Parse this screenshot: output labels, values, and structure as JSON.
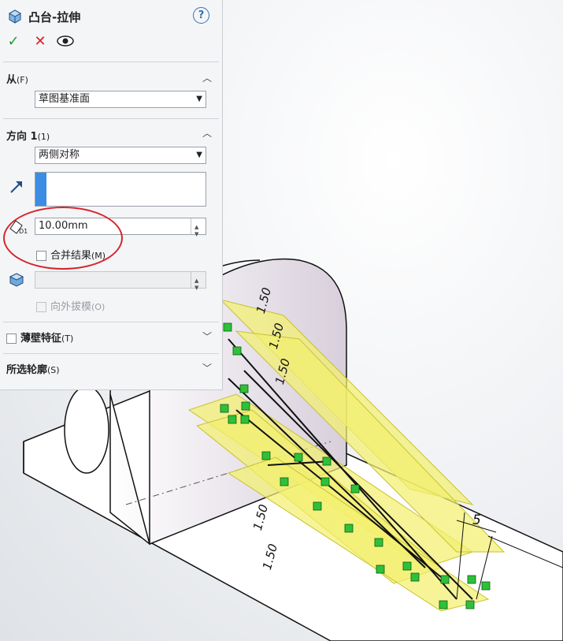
{
  "feature": {
    "title": "凸台-拉伸",
    "help": "?"
  },
  "actions": {
    "ok": "✓",
    "cancel": "✕"
  },
  "from": {
    "section": "从",
    "accel": "(F)",
    "value": "草图基准面"
  },
  "direction1": {
    "section": "方向 1",
    "accel": "(1)",
    "end_condition": "两侧对称",
    "depth": "10.00mm",
    "depth_icon_label": "D1",
    "merge_result": {
      "label": "合并结果",
      "accel": "(M)",
      "checked": false
    },
    "draft_outward": {
      "label": "向外拔模",
      "accel": "(O)",
      "checked": false,
      "enabled": false
    }
  },
  "thin_feature": {
    "label": "薄壁特征",
    "accel": "(T)",
    "checked": false
  },
  "selected_contours": {
    "label": "所选轮廓",
    "accel": "(S)"
  },
  "viewport": {
    "dimensions": [
      "1.50",
      "1.50",
      "1.50",
      "1.50",
      "1.50",
      "5"
    ],
    "relations": [
      "25",
      "20",
      "25",
      "27",
      "20",
      "25",
      "26",
      "32",
      "19",
      "28",
      "13",
      "27",
      "15",
      "13",
      "21",
      "27",
      "28",
      "13",
      "17",
      "19",
      "27",
      "15",
      "13"
    ]
  },
  "colors": {
    "accent": "#3b8de3",
    "annotation_red": "#d6252b",
    "relation_green": "#2fc03a",
    "extrude_yellow": "#f4f27a"
  }
}
